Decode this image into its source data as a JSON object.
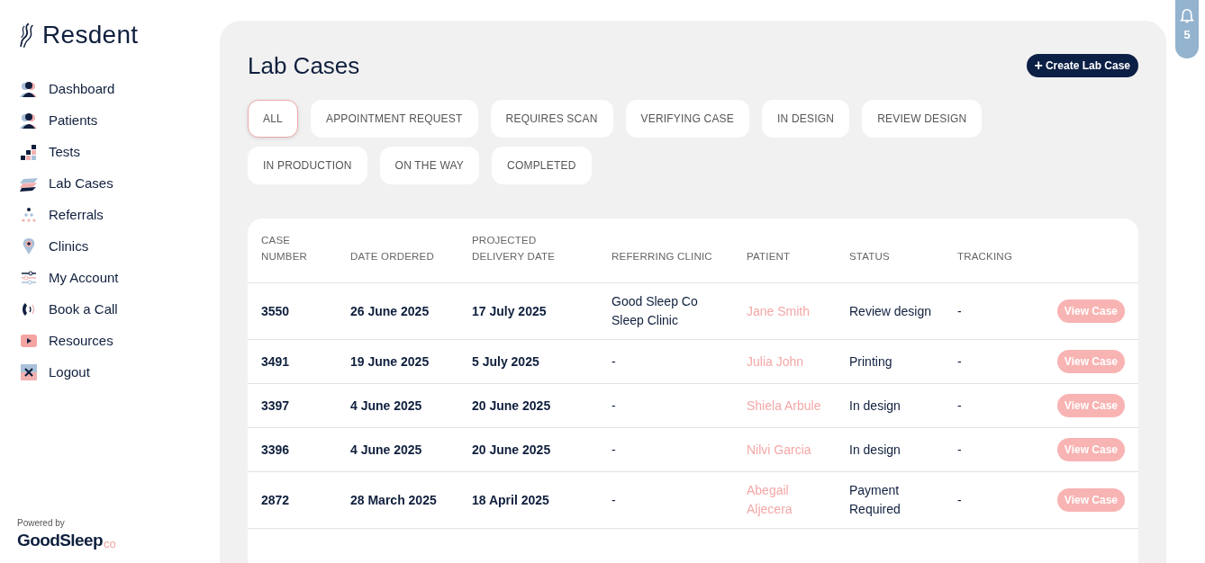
{
  "brand": {
    "name": "Resdent"
  },
  "sidebar": {
    "items": [
      {
        "label": "Dashboard"
      },
      {
        "label": "Patients"
      },
      {
        "label": "Tests"
      },
      {
        "label": "Lab Cases"
      },
      {
        "label": "Referrals"
      },
      {
        "label": "Clinics"
      },
      {
        "label": "My Account"
      },
      {
        "label": "Book a Call"
      },
      {
        "label": "Resources"
      },
      {
        "label": "Logout"
      }
    ],
    "footer": {
      "powered_by": "Powered by",
      "logo_main": "GoodSleep",
      "logo_suffix": "co"
    }
  },
  "notifications": {
    "count": "5"
  },
  "page": {
    "title": "Lab Cases",
    "create_button": "Create Lab Case",
    "create_icon": "+"
  },
  "filters": [
    {
      "label": "ALL",
      "selected": true
    },
    {
      "label": "APPOINTMENT REQUEST",
      "selected": false
    },
    {
      "label": "REQUIRES SCAN",
      "selected": false
    },
    {
      "label": "VERIFYING CASE",
      "selected": false
    },
    {
      "label": "IN DESIGN",
      "selected": false
    },
    {
      "label": "REVIEW DESIGN",
      "selected": false
    },
    {
      "label": "IN PRODUCTION",
      "selected": false
    },
    {
      "label": "ON THE WAY",
      "selected": false
    },
    {
      "label": "COMPLETED",
      "selected": false
    }
  ],
  "table": {
    "columns": [
      "CASE NUMBER",
      "DATE ORDERED",
      "PROJECTED DELIVERY DATE",
      "REFERRING CLINIC",
      "PATIENT",
      "STATUS",
      "TRACKING"
    ],
    "rows": [
      {
        "case_number": "3550",
        "date_ordered": "26 June 2025",
        "projected_delivery": "17 July 2025",
        "referring_clinic": "Good Sleep Co Sleep Clinic",
        "patient": "Jane Smith",
        "status": "Review design",
        "tracking": "-",
        "action": "View Case"
      },
      {
        "case_number": "3491",
        "date_ordered": "19 June 2025",
        "projected_delivery": "5 July 2025",
        "referring_clinic": "-",
        "patient": "Julia John",
        "status": "Printing",
        "tracking": "-",
        "action": "View Case"
      },
      {
        "case_number": "3397",
        "date_ordered": "4 June 2025",
        "projected_delivery": "20 June 2025",
        "referring_clinic": "-",
        "patient": "Shiela Arbule",
        "status": "In design",
        "tracking": "-",
        "action": "View Case"
      },
      {
        "case_number": "3396",
        "date_ordered": "4 June 2025",
        "projected_delivery": "20 June 2025",
        "referring_clinic": "-",
        "patient": "Nilvi Garcia",
        "status": "In design",
        "tracking": "-",
        "action": "View Case"
      },
      {
        "case_number": "2872",
        "date_ordered": "28 March 2025",
        "projected_delivery": "18 April 2025",
        "referring_clinic": "-",
        "patient": "Abegail Aljecera",
        "status": "Payment Required",
        "tracking": "-",
        "action": "View Case"
      }
    ]
  }
}
